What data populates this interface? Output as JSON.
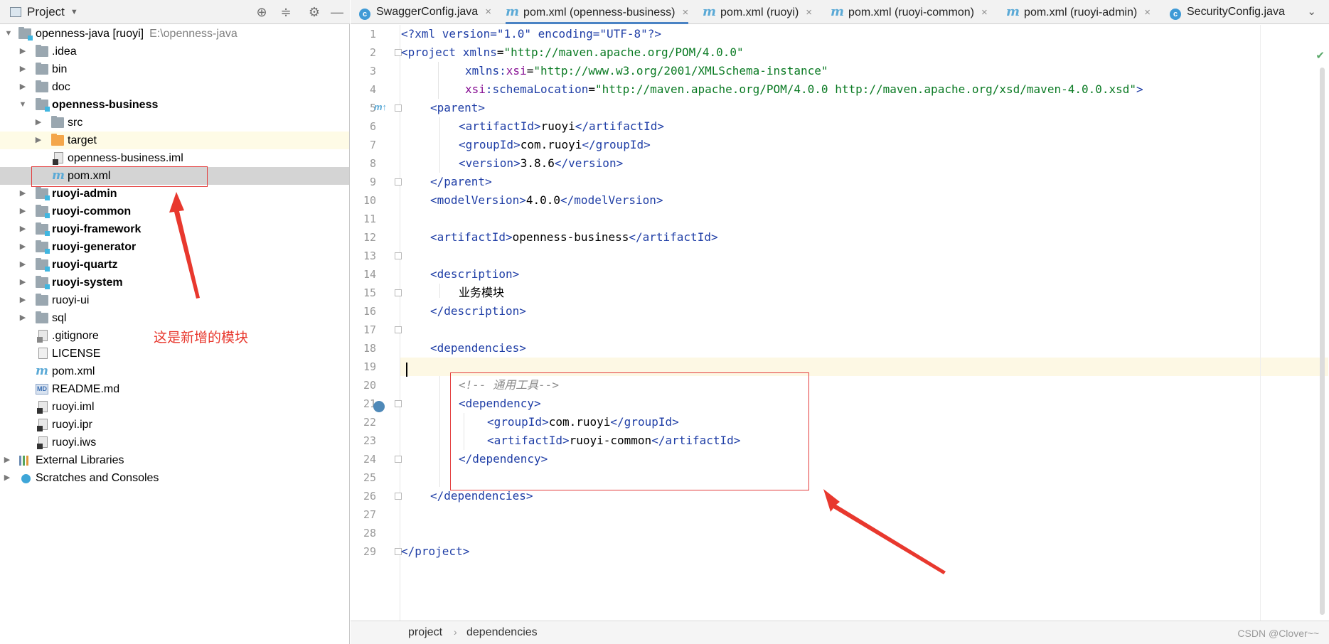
{
  "project_panel": {
    "title": "Project",
    "toolbar_icons": [
      "locate-icon",
      "collapse-all-icon",
      "gear-icon",
      "minimize-icon"
    ],
    "root": {
      "name": "openness-java [ruoyi]",
      "path": "E:\\openness-java"
    },
    "items": [
      {
        "label": ".idea"
      },
      {
        "label": "bin"
      },
      {
        "label": "doc"
      },
      {
        "label": "openness-business"
      },
      {
        "label": "src"
      },
      {
        "label": "target"
      },
      {
        "label": "openness-business.iml"
      },
      {
        "label": "pom.xml"
      },
      {
        "label": "ruoyi-admin"
      },
      {
        "label": "ruoyi-common"
      },
      {
        "label": "ruoyi-framework"
      },
      {
        "label": "ruoyi-generator"
      },
      {
        "label": "ruoyi-quartz"
      },
      {
        "label": "ruoyi-system"
      },
      {
        "label": "ruoyi-ui"
      },
      {
        "label": "sql"
      },
      {
        "label": ".gitignore"
      },
      {
        "label": "LICENSE"
      },
      {
        "label": "pom.xml"
      },
      {
        "label": "README.md"
      },
      {
        "label": "ruoyi.iml"
      },
      {
        "label": "ruoyi.ipr"
      },
      {
        "label": "ruoyi.iws"
      },
      {
        "label": "External Libraries"
      },
      {
        "label": "Scratches and Consoles"
      }
    ],
    "annotation": "这是新增的模块"
  },
  "editor": {
    "tabs": [
      {
        "label": "SwaggerConfig.java",
        "kind": "java"
      },
      {
        "label": "pom.xml (openness-business)",
        "kind": "maven"
      },
      {
        "label": "pom.xml (ruoyi)",
        "kind": "maven"
      },
      {
        "label": "pom.xml (ruoyi-common)",
        "kind": "maven"
      },
      {
        "label": "pom.xml (ruoyi-admin)",
        "kind": "maven"
      },
      {
        "label": "SecurityConfig.java",
        "kind": "java"
      }
    ],
    "active_tab": 1,
    "close_glyph": "×",
    "tabs_more": "⌄",
    "line_numbers": [
      "1",
      "2",
      "3",
      "4",
      "5",
      "6",
      "7",
      "8",
      "9",
      "10",
      "11",
      "12",
      "13",
      "14",
      "15",
      "16",
      "17",
      "18",
      "19",
      "20",
      "21",
      "22",
      "23",
      "24",
      "25",
      "26",
      "27",
      "28",
      "29"
    ],
    "code": {
      "l1_decl": "<?xml version=\"1.0\" encoding=\"UTF-8\"?>",
      "l2_open": "<project",
      "l2_attr": " xmlns",
      "l2_eq": "=",
      "l2_val": "\"http://maven.apache.org/POM/4.0.0\"",
      "l3_attr_ns": "xmlns:",
      "l3_attr": "xsi",
      "l3_eq": "=",
      "l3_val": "\"http://www.w3.org/2001/XMLSchema-instance\"",
      "l4_attr_ns": "xsi",
      "l4_attr": ":schemaLocation",
      "l4_eq": "=",
      "l4_val": "\"http://maven.apache.org/POM/4.0.0 http://maven.apache.org/xsd/maven-4.0.0.xsd\"",
      "l4_close": ">",
      "parent_open": "<parent>",
      "artifact_open": "<artifactId>",
      "artifact_close": "</artifactId>",
      "group_open": "<groupId>",
      "group_close": "</groupId>",
      "version_open": "<version>",
      "version_close": "</version>",
      "parent_close": "</parent>",
      "model_open": "<modelVersion>",
      "model_close": "</modelVersion>",
      "desc_open": "<description>",
      "desc_close": "</description>",
      "deps_open": "<dependencies>",
      "deps_close": "</dependencies>",
      "dep_open": "<dependency>",
      "dep_close": "</dependency>",
      "project_close": "</project>",
      "parent_artifact": "ruoyi",
      "parent_group": "com.ruoyi",
      "parent_version": "3.8.6",
      "model_version": "4.0.0",
      "artifact_id": "openness-business",
      "description": "业务模块",
      "comment": "<!-- 通用工具-->",
      "dep_group": "com.ruoyi",
      "dep_artifact": "ruoyi-common"
    }
  },
  "breadcrumb": [
    "project",
    "dependencies"
  ],
  "breadcrumb_sep": "›",
  "watermark": "CSDN @Clover~~",
  "colors": {
    "annotation_red": "#e33b3b",
    "xml_tag": "#1f3ea6",
    "xml_value": "#0a7a23",
    "ns_attr": "#871094"
  }
}
